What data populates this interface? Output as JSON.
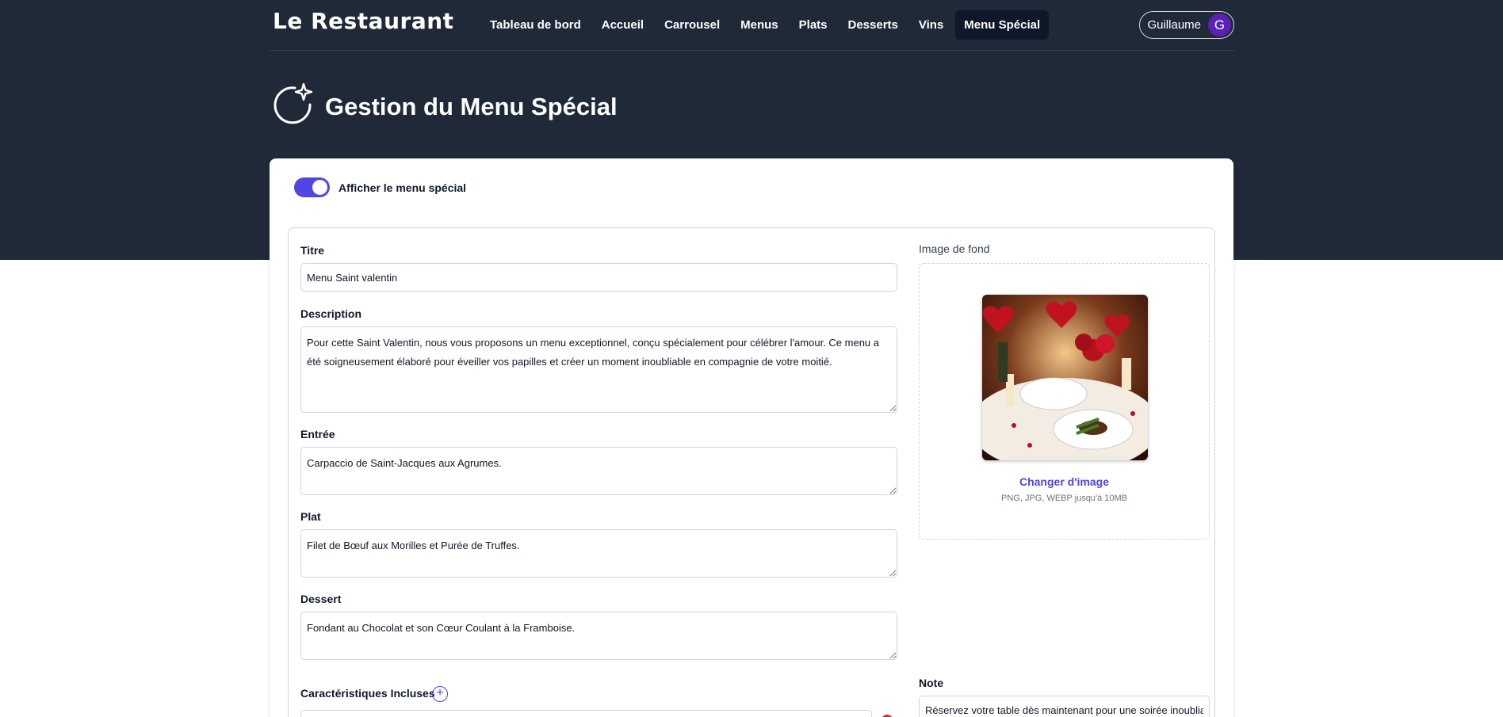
{
  "brand": {
    "logo_text": "Le Restaurant"
  },
  "nav": {
    "items": [
      {
        "label": "Tableau de bord"
      },
      {
        "label": "Accueil"
      },
      {
        "label": "Carrousel"
      },
      {
        "label": "Menus"
      },
      {
        "label": "Plats"
      },
      {
        "label": "Desserts"
      },
      {
        "label": "Vins"
      },
      {
        "label": "Menu Spécial",
        "active": true
      }
    ]
  },
  "user": {
    "name": "Guillaume",
    "initial": "G"
  },
  "page": {
    "title": "Gestion du Menu Spécial"
  },
  "toggle": {
    "label": "Afficher le menu spécial",
    "checked": true
  },
  "form": {
    "title_label": "Titre",
    "title_value": "Menu Saint valentin",
    "description_label": "Description",
    "description_value": "Pour cette Saint Valentin, nous vous proposons un menu exceptionnel, conçu spécialement pour célébrer l'amour. Ce menu a été soigneusement élaboré pour éveiller vos papilles et créer un moment inoubliable en compagnie de votre moitié.",
    "entree_label": "Entrée",
    "entree_value": "Carpaccio de Saint-Jacques aux Agrumes.",
    "plat_label": "Plat",
    "plat_value": "Filet de Bœuf aux Morilles et Purée de Truffes.",
    "dessert_label": "Dessert",
    "dessert_value": "Fondant au Chocolat et son Cœur Coulant à la Framboise.",
    "features_label": "Caractéristiques Incluses",
    "image_label": "Image de fond",
    "change_image_label": "Changer d'image",
    "file_hint": "PNG, JPG, WEBP jusqu'à 10MB",
    "note_label": "Note",
    "note_value": "Réservez votre table dès maintenant pour une soirée inoubliable."
  },
  "colors": {
    "header_bg": "#1f2937",
    "accent": "#4f46e5",
    "avatar": "#5b21b6"
  }
}
